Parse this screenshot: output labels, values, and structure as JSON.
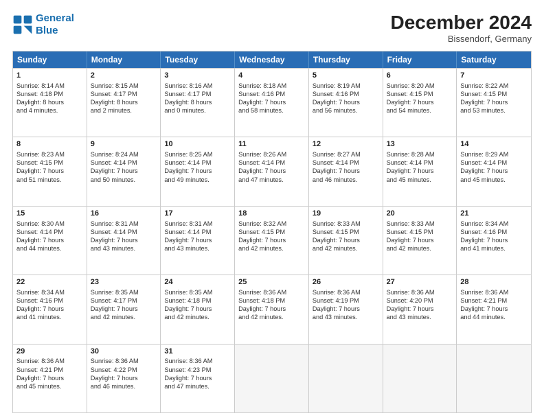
{
  "header": {
    "logo_line1": "General",
    "logo_line2": "Blue",
    "month": "December 2024",
    "location": "Bissendorf, Germany"
  },
  "days_of_week": [
    "Sunday",
    "Monday",
    "Tuesday",
    "Wednesday",
    "Thursday",
    "Friday",
    "Saturday"
  ],
  "weeks": [
    [
      {
        "day": "1",
        "lines": [
          "Sunrise: 8:14 AM",
          "Sunset: 4:18 PM",
          "Daylight: 8 hours",
          "and 4 minutes."
        ]
      },
      {
        "day": "2",
        "lines": [
          "Sunrise: 8:15 AM",
          "Sunset: 4:17 PM",
          "Daylight: 8 hours",
          "and 2 minutes."
        ]
      },
      {
        "day": "3",
        "lines": [
          "Sunrise: 8:16 AM",
          "Sunset: 4:17 PM",
          "Daylight: 8 hours",
          "and 0 minutes."
        ]
      },
      {
        "day": "4",
        "lines": [
          "Sunrise: 8:18 AM",
          "Sunset: 4:16 PM",
          "Daylight: 7 hours",
          "and 58 minutes."
        ]
      },
      {
        "day": "5",
        "lines": [
          "Sunrise: 8:19 AM",
          "Sunset: 4:16 PM",
          "Daylight: 7 hours",
          "and 56 minutes."
        ]
      },
      {
        "day": "6",
        "lines": [
          "Sunrise: 8:20 AM",
          "Sunset: 4:15 PM",
          "Daylight: 7 hours",
          "and 54 minutes."
        ]
      },
      {
        "day": "7",
        "lines": [
          "Sunrise: 8:22 AM",
          "Sunset: 4:15 PM",
          "Daylight: 7 hours",
          "and 53 minutes."
        ]
      }
    ],
    [
      {
        "day": "8",
        "lines": [
          "Sunrise: 8:23 AM",
          "Sunset: 4:15 PM",
          "Daylight: 7 hours",
          "and 51 minutes."
        ]
      },
      {
        "day": "9",
        "lines": [
          "Sunrise: 8:24 AM",
          "Sunset: 4:14 PM",
          "Daylight: 7 hours",
          "and 50 minutes."
        ]
      },
      {
        "day": "10",
        "lines": [
          "Sunrise: 8:25 AM",
          "Sunset: 4:14 PM",
          "Daylight: 7 hours",
          "and 49 minutes."
        ]
      },
      {
        "day": "11",
        "lines": [
          "Sunrise: 8:26 AM",
          "Sunset: 4:14 PM",
          "Daylight: 7 hours",
          "and 47 minutes."
        ]
      },
      {
        "day": "12",
        "lines": [
          "Sunrise: 8:27 AM",
          "Sunset: 4:14 PM",
          "Daylight: 7 hours",
          "and 46 minutes."
        ]
      },
      {
        "day": "13",
        "lines": [
          "Sunrise: 8:28 AM",
          "Sunset: 4:14 PM",
          "Daylight: 7 hours",
          "and 45 minutes."
        ]
      },
      {
        "day": "14",
        "lines": [
          "Sunrise: 8:29 AM",
          "Sunset: 4:14 PM",
          "Daylight: 7 hours",
          "and 45 minutes."
        ]
      }
    ],
    [
      {
        "day": "15",
        "lines": [
          "Sunrise: 8:30 AM",
          "Sunset: 4:14 PM",
          "Daylight: 7 hours",
          "and 44 minutes."
        ]
      },
      {
        "day": "16",
        "lines": [
          "Sunrise: 8:31 AM",
          "Sunset: 4:14 PM",
          "Daylight: 7 hours",
          "and 43 minutes."
        ]
      },
      {
        "day": "17",
        "lines": [
          "Sunrise: 8:31 AM",
          "Sunset: 4:14 PM",
          "Daylight: 7 hours",
          "and 43 minutes."
        ]
      },
      {
        "day": "18",
        "lines": [
          "Sunrise: 8:32 AM",
          "Sunset: 4:15 PM",
          "Daylight: 7 hours",
          "and 42 minutes."
        ]
      },
      {
        "day": "19",
        "lines": [
          "Sunrise: 8:33 AM",
          "Sunset: 4:15 PM",
          "Daylight: 7 hours",
          "and 42 minutes."
        ]
      },
      {
        "day": "20",
        "lines": [
          "Sunrise: 8:33 AM",
          "Sunset: 4:15 PM",
          "Daylight: 7 hours",
          "and 42 minutes."
        ]
      },
      {
        "day": "21",
        "lines": [
          "Sunrise: 8:34 AM",
          "Sunset: 4:16 PM",
          "Daylight: 7 hours",
          "and 41 minutes."
        ]
      }
    ],
    [
      {
        "day": "22",
        "lines": [
          "Sunrise: 8:34 AM",
          "Sunset: 4:16 PM",
          "Daylight: 7 hours",
          "and 41 minutes."
        ]
      },
      {
        "day": "23",
        "lines": [
          "Sunrise: 8:35 AM",
          "Sunset: 4:17 PM",
          "Daylight: 7 hours",
          "and 42 minutes."
        ]
      },
      {
        "day": "24",
        "lines": [
          "Sunrise: 8:35 AM",
          "Sunset: 4:18 PM",
          "Daylight: 7 hours",
          "and 42 minutes."
        ]
      },
      {
        "day": "25",
        "lines": [
          "Sunrise: 8:36 AM",
          "Sunset: 4:18 PM",
          "Daylight: 7 hours",
          "and 42 minutes."
        ]
      },
      {
        "day": "26",
        "lines": [
          "Sunrise: 8:36 AM",
          "Sunset: 4:19 PM",
          "Daylight: 7 hours",
          "and 43 minutes."
        ]
      },
      {
        "day": "27",
        "lines": [
          "Sunrise: 8:36 AM",
          "Sunset: 4:20 PM",
          "Daylight: 7 hours",
          "and 43 minutes."
        ]
      },
      {
        "day": "28",
        "lines": [
          "Sunrise: 8:36 AM",
          "Sunset: 4:21 PM",
          "Daylight: 7 hours",
          "and 44 minutes."
        ]
      }
    ],
    [
      {
        "day": "29",
        "lines": [
          "Sunrise: 8:36 AM",
          "Sunset: 4:21 PM",
          "Daylight: 7 hours",
          "and 45 minutes."
        ]
      },
      {
        "day": "30",
        "lines": [
          "Sunrise: 8:36 AM",
          "Sunset: 4:22 PM",
          "Daylight: 7 hours",
          "and 46 minutes."
        ]
      },
      {
        "day": "31",
        "lines": [
          "Sunrise: 8:36 AM",
          "Sunset: 4:23 PM",
          "Daylight: 7 hours",
          "and 47 minutes."
        ]
      },
      null,
      null,
      null,
      null
    ]
  ]
}
